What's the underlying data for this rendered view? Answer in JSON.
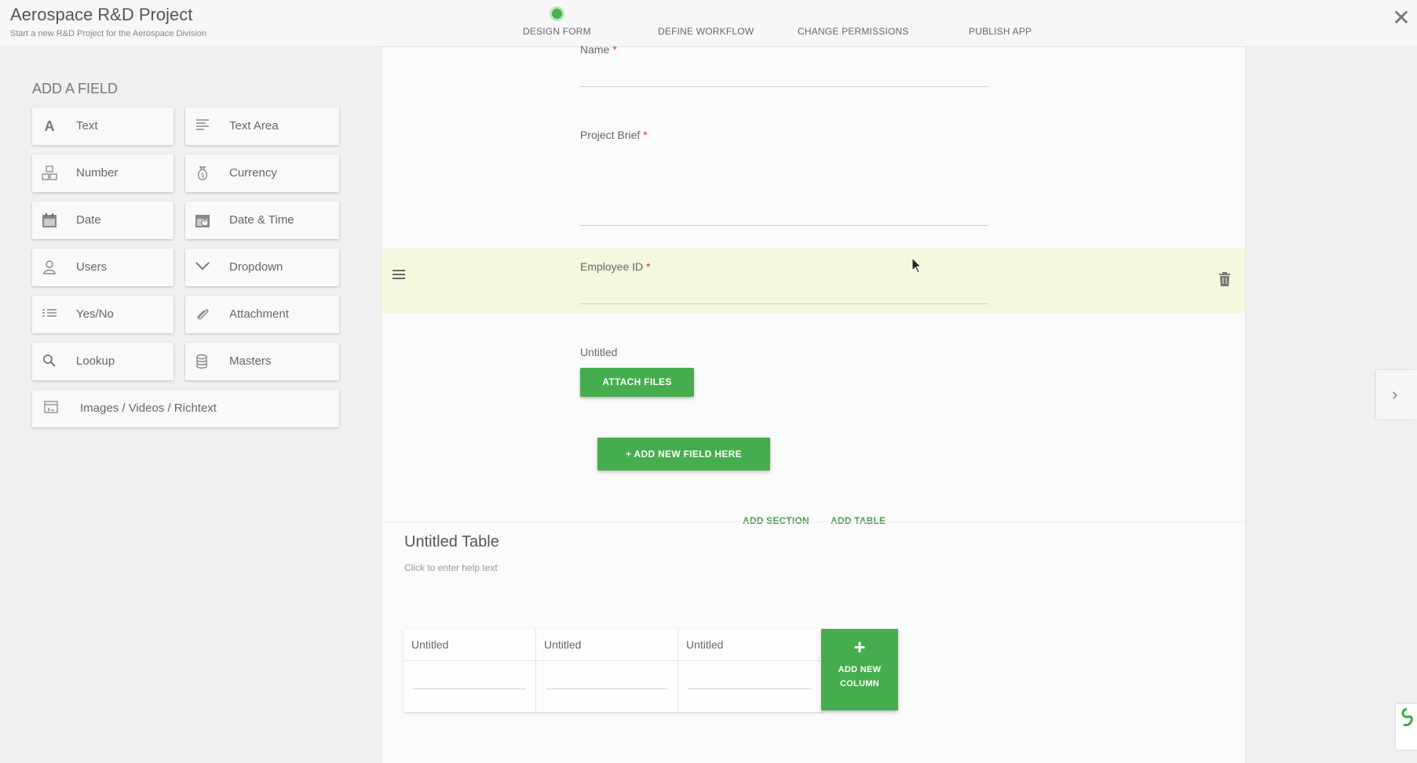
{
  "header": {
    "title": "Aerospace R&D Project",
    "subtitle": "Start a new R&D Project for the Aerospace Division",
    "steps": [
      {
        "label": "DESIGN FORM",
        "active": true
      },
      {
        "label": "DEFINE WORKFLOW",
        "active": false
      },
      {
        "label": "CHANGE PERMISSIONS",
        "active": false
      },
      {
        "label": "PUBLISH APP",
        "active": false
      }
    ],
    "close_icon": "close-icon"
  },
  "palette": {
    "title": "ADD A FIELD",
    "items": [
      {
        "label": "Text",
        "icon": "text-icon"
      },
      {
        "label": "Text Area",
        "icon": "text-area-icon"
      },
      {
        "label": "Number",
        "icon": "number-icon"
      },
      {
        "label": "Currency",
        "icon": "currency-icon"
      },
      {
        "label": "Date",
        "icon": "calendar-icon"
      },
      {
        "label": "Date & Time",
        "icon": "calendar-clock-icon"
      },
      {
        "label": "Users",
        "icon": "user-icon"
      },
      {
        "label": "Dropdown",
        "icon": "chevron-down-icon"
      },
      {
        "label": "Yes/No",
        "icon": "toggle-list-icon"
      },
      {
        "label": "Attachment",
        "icon": "paperclip-icon"
      },
      {
        "label": "Lookup",
        "icon": "search-icon"
      },
      {
        "label": "Masters",
        "icon": "database-icon"
      },
      {
        "label": "Images / Videos / Richtext",
        "icon": "media-icon"
      }
    ]
  },
  "form": {
    "fields": [
      {
        "label": "Name",
        "required": "*"
      },
      {
        "label": "Project Brief",
        "required": "*"
      },
      {
        "label": "Employee ID",
        "required": "*"
      }
    ],
    "attachment_field": {
      "label": "Untitled",
      "button": "ATTACH FILES"
    },
    "add_field_button": "+ ADD NEW FIELD HERE",
    "add_section": "ADD SECTION",
    "add_table": "ADD TABLE",
    "table": {
      "title": "Untitled Table",
      "help_text": "Click to enter help text",
      "columns": [
        "Untitled",
        "Untitled",
        "Untitled"
      ],
      "add_column_plus": "+",
      "add_column_line1": "ADD NEW",
      "add_column_line2": "COLUMN"
    }
  },
  "colors": {
    "accent_green": "#45ad4e",
    "highlight_row": "#f5f7de",
    "required_red": "#d33333"
  }
}
